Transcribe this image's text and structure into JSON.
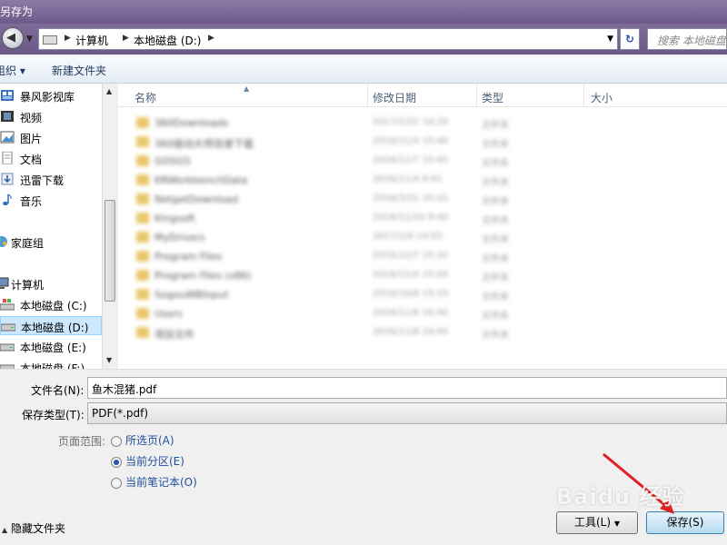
{
  "window": {
    "title": "另存为"
  },
  "address": {
    "crumbs": [
      "计算机",
      "本地磁盘 (D:)"
    ],
    "search_placeholder": "搜索 本地磁盘 (D:)"
  },
  "toolbar": {
    "organize": "组织",
    "new_folder": "新建文件夹"
  },
  "sidebar": {
    "items": [
      {
        "label": "暴风影视库",
        "icon": "video-library-icon"
      },
      {
        "label": "视频",
        "icon": "video-icon"
      },
      {
        "label": "图片",
        "icon": "pictures-icon"
      },
      {
        "label": "文档",
        "icon": "documents-icon"
      },
      {
        "label": "迅雷下载",
        "icon": "download-icon"
      },
      {
        "label": "音乐",
        "icon": "music-icon"
      },
      {
        "label": "家庭组",
        "icon": "homegroup-icon"
      },
      {
        "label": "计算机",
        "icon": "computer-icon"
      },
      {
        "label": "本地磁盘 (C:)",
        "icon": "drive-icon"
      },
      {
        "label": "本地磁盘 (D:)",
        "icon": "drive-icon"
      },
      {
        "label": "本地磁盘 (E:)",
        "icon": "drive-icon"
      },
      {
        "label": "本地磁盘 (F:)",
        "icon": "drive-icon"
      }
    ]
  },
  "filelist": {
    "columns": [
      "名称",
      "修改日期",
      "类型",
      "大小"
    ],
    "rows": [
      {
        "name": "360Downloads",
        "date": "2017/2/22 16:20",
        "type": "文件夹"
      },
      {
        "name": "360驱动大师目录下载",
        "date": "2016/11/4 15:40",
        "type": "文件夹"
      },
      {
        "name": "GOSGS",
        "date": "2016/11/7 15:45",
        "type": "文件夹"
      },
      {
        "name": "KRWorkbenchData",
        "date": "2016/11/4 9:41",
        "type": "文件夹"
      },
      {
        "name": "NetgetDownload",
        "date": "2016/3/31 10:22",
        "type": "文件夹"
      },
      {
        "name": "Kingsoft",
        "date": "2016/11/10 9:40",
        "type": "文件夹"
      },
      {
        "name": "MyDrivers",
        "date": "2017/1/9 14:55",
        "type": "文件夹"
      },
      {
        "name": "Program Files",
        "date": "2016/12/7 15:32",
        "type": "文件夹"
      },
      {
        "name": "Program Files (x86)",
        "date": "2016/12/4 15:05",
        "type": "文件夹"
      },
      {
        "name": "SogouWBInput",
        "date": "2016/10/8 15:33",
        "type": "文件夹"
      },
      {
        "name": "Users",
        "date": "2016/11/8 16:40",
        "type": "文件夹"
      },
      {
        "name": "项目文件",
        "date": "2016/11/8 16:44",
        "type": "文件夹"
      }
    ]
  },
  "form": {
    "filename_label": "文件名(N):",
    "filename_value": "鱼木混猪.pdf",
    "filetype_label": "保存类型(T):",
    "filetype_value": "PDF(*.pdf)",
    "page_range_label": "页面范围:",
    "options": [
      "所选页(A)",
      "当前分区(E)",
      "当前笔记本(O)"
    ],
    "hide_folders": "隐藏文件夹",
    "tools_label": "工具(L)",
    "save_label": "保存(S)"
  },
  "watermark": "Baidu 经验",
  "colors": {
    "selection": "#cce8ff",
    "title_bar": "#6d5a8a",
    "link": "#1e4f9c"
  }
}
